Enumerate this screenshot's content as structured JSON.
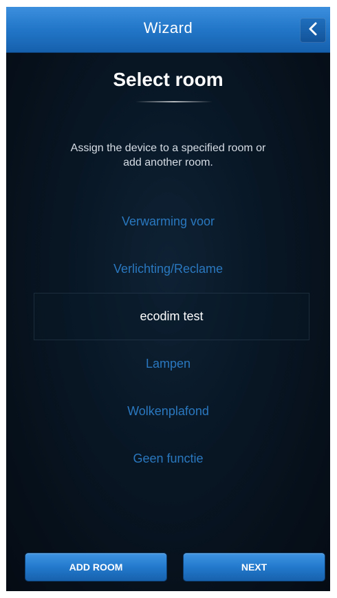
{
  "header": {
    "title": "Wizard",
    "back_icon": "chevron-left-icon"
  },
  "page": {
    "title": "Select room",
    "instruction_line1": "Assign the device to a specified room or",
    "instruction_line2": "add another room."
  },
  "rooms": [
    {
      "label": "Verwarming voor",
      "selected": false
    },
    {
      "label": "Verlichting/Reclame",
      "selected": false
    },
    {
      "label": "ecodim test",
      "selected": true
    },
    {
      "label": "Lampen",
      "selected": false
    },
    {
      "label": "Wolkenplafond",
      "selected": false
    },
    {
      "label": "Geen functie",
      "selected": false
    }
  ],
  "footer": {
    "add_room_label": "ADD ROOM",
    "next_label": "NEXT"
  },
  "colors": {
    "accent": "#2276c8",
    "room_text": "#2a78bf",
    "selected_text": "#ffffff",
    "background": "#081624"
  }
}
